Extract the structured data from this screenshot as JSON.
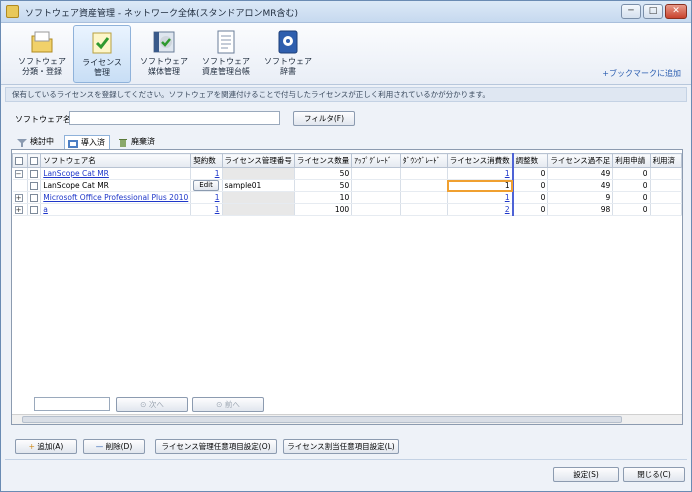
{
  "window": {
    "title": "ソフトウェア資産管理 - ネットワーク全体(スタンドアロンMR含む)",
    "min": "─",
    "max": "□",
    "close": "✕"
  },
  "ribbon": {
    "tabs": [
      {
        "line1": "ソフトウェア",
        "line2": "分類・登録",
        "icon": "folder-icon"
      },
      {
        "line1": "ライセンス",
        "line2": "管理",
        "icon": "license-check-icon"
      },
      {
        "line1": "ソフトウェア",
        "line2": "媒体管理",
        "icon": "media-check-icon"
      },
      {
        "line1": "ソフトウェア",
        "line2": "資産管理台帳",
        "icon": "ledger-icon"
      },
      {
        "line1": "ソフトウェア",
        "line2": "辞書",
        "icon": "dictionary-icon"
      }
    ],
    "bookmark": "+ブックマークに追加"
  },
  "info": "保有しているライセンスを登録してください。ソフトウェアを関連付けることで付与したライセンスが正しく利用されているかが分かります。",
  "filter": {
    "label": "ソフトウェア名",
    "value": "",
    "button": "フィルタ(F)"
  },
  "subtabs": [
    {
      "label": "検討中"
    },
    {
      "label": "導入済"
    },
    {
      "label": "廃棄済"
    }
  ],
  "grid": {
    "columns": [
      "",
      "",
      "ソフトウェア名",
      "契約数",
      "ライセンス管理番号",
      "ライセンス数量",
      "ｱｯﾌﾟｸﾞﾚｰﾄﾞ",
      "ﾀﾞｳﾝｸﾞﾚｰﾄﾞ",
      "ライセンス消費数",
      "調整数",
      "ライセンス過不足",
      "利用申請",
      "利用済"
    ],
    "rows": [
      {
        "exp": "−",
        "name": "LanScope Cat MR",
        "contract": "1",
        "mgmt": "",
        "qty": "50",
        "up": "",
        "down": "",
        "consumed": "1",
        "adjust": "0",
        "diff": "49",
        "apply": "0",
        "used": ""
      },
      {
        "exp": "",
        "name": "LanScope Cat MR",
        "contract": "Edit",
        "mgmt": "sample01",
        "qty": "50",
        "up": "",
        "down": "",
        "consumed": "1",
        "adjust": "0",
        "diff": "49",
        "apply": "0",
        "used": ""
      },
      {
        "exp": "+",
        "name": "Microsoft Office Professional Plus 2010",
        "contract": "1",
        "mgmt": "",
        "qty": "10",
        "up": "",
        "down": "",
        "consumed": "1",
        "adjust": "0",
        "diff": "9",
        "apply": "0",
        "used": ""
      },
      {
        "exp": "+",
        "name": "a",
        "contract": "1",
        "mgmt": "",
        "qty": "100",
        "up": "",
        "down": "",
        "consumed": "2",
        "adjust": "0",
        "diff": "98",
        "apply": "0",
        "used": ""
      }
    ],
    "search_value": "",
    "next": "次へ",
    "prev": "前へ"
  },
  "actions": {
    "add": "追加(A)",
    "delete": "削除(D)",
    "mgmt_setting": "ライセンス管理任意項目設定(O)",
    "alloc_setting": "ライセンス割当任意項目設定(L)"
  },
  "footer": {
    "settings": "設定(S)",
    "close": "閉じる(C)"
  }
}
